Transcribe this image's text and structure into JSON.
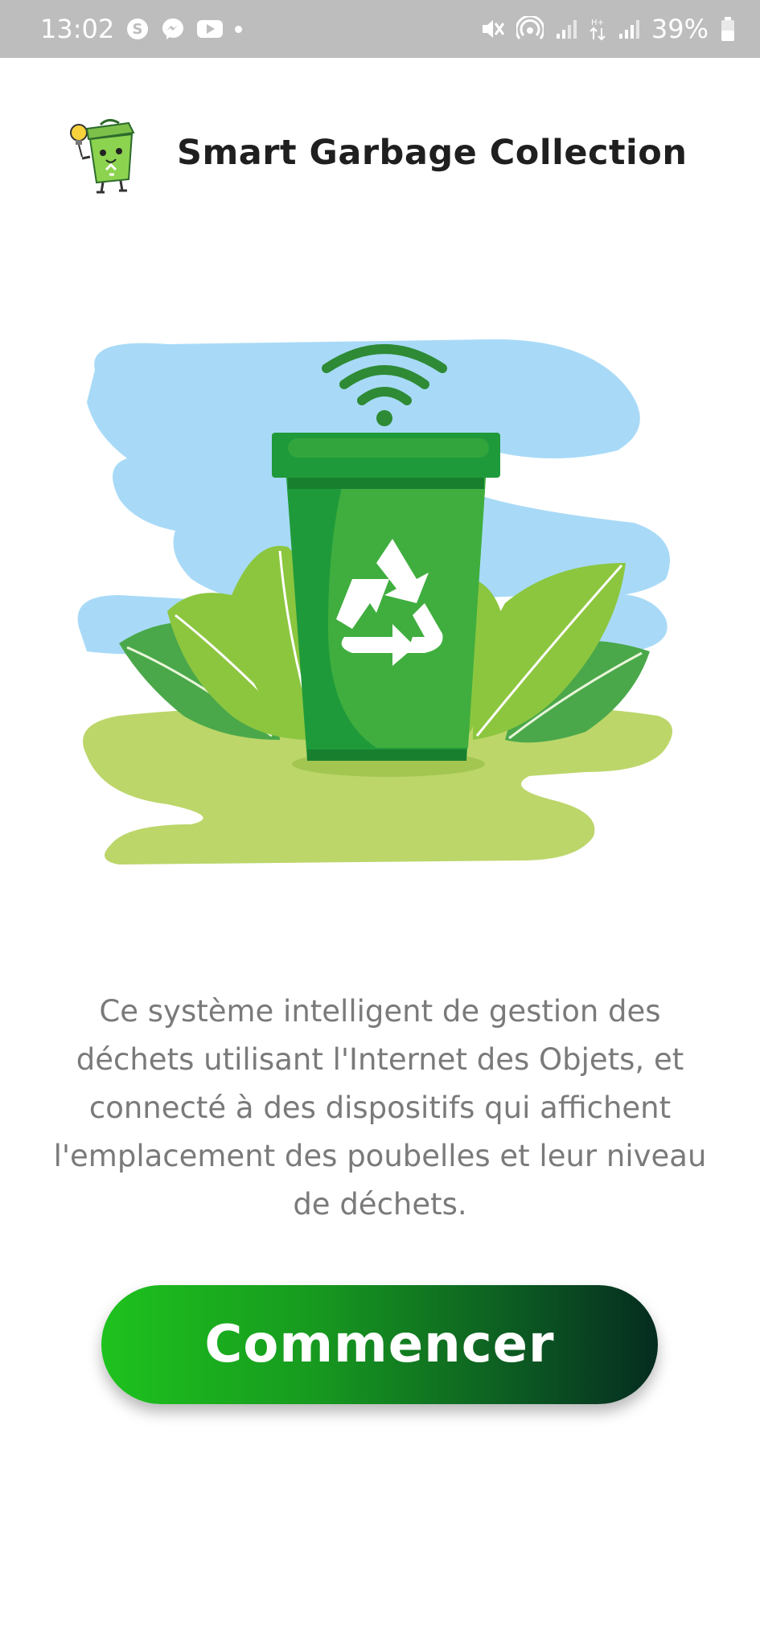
{
  "status_bar": {
    "time": "13:02",
    "battery": "39%",
    "left_icons": [
      "skype-icon",
      "messenger-icon",
      "youtube-icon",
      "notification-dot-icon"
    ],
    "right_icons": [
      "mute-vibrate-icon",
      "hotspot-icon",
      "signal-icon",
      "data-arrows-icon",
      "signal-icon",
      "battery-icon"
    ],
    "background": "#bdbdbd"
  },
  "header": {
    "title": "Smart Garbage Collection",
    "logo_icon": "green-trash-bin-mascot-icon"
  },
  "hero": {
    "illustration_icon": "smart-recycling-bin-illustration",
    "colors": {
      "sky": "#a7d9f7",
      "ground": "#bcd66a",
      "bin_dark": "#1f9a3a",
      "bin_light": "#3fae3e",
      "leaf": "#8cc63f"
    }
  },
  "description": "Ce système intelligent de gestion des déchets utilisant l'Internet des Objets, et connecté à des dispositifs qui affichent l'emplacement des poubelles et leur niveau de déchets.",
  "button": {
    "label": "Commencer",
    "gradient_start": "#1ec21e",
    "gradient_end": "#052b20"
  }
}
